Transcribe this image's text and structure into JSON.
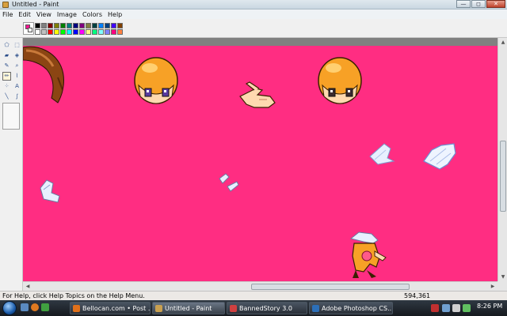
{
  "window": {
    "title": "Untitled - Paint"
  },
  "window_controls": {
    "minimize": "—",
    "maximize": "◻",
    "close": "✕"
  },
  "menu": [
    "File",
    "Edit",
    "View",
    "Image",
    "Colors",
    "Help"
  ],
  "palette": {
    "foreground": "#ff1493",
    "background": "#f2f2f2",
    "colors": [
      "#000000",
      "#808080",
      "#800000",
      "#808000",
      "#008000",
      "#008080",
      "#000080",
      "#800080",
      "#808040",
      "#004040",
      "#0080ff",
      "#004080",
      "#4000ff",
      "#804000",
      "#ffffff",
      "#c0c0c0",
      "#ff0000",
      "#ffff00",
      "#00ff00",
      "#00ffff",
      "#0000ff",
      "#ff00ff",
      "#ffff80",
      "#00ff80",
      "#80ffff",
      "#8080ff",
      "#ff0080",
      "#ff8040"
    ]
  },
  "tools": [
    {
      "name": "free-select-icon",
      "glyph": "⬠"
    },
    {
      "name": "rect-select-icon",
      "glyph": "⬚"
    },
    {
      "name": "eraser-icon",
      "glyph": "▰"
    },
    {
      "name": "fill-icon",
      "glyph": "◈"
    },
    {
      "name": "eyedropper-icon",
      "glyph": "✎"
    },
    {
      "name": "magnifier-icon",
      "glyph": "⌕"
    },
    {
      "name": "pencil-icon",
      "glyph": "✏",
      "active": true
    },
    {
      "name": "brush-icon",
      "glyph": "⌇"
    },
    {
      "name": "airbrush-icon",
      "glyph": "⁘"
    },
    {
      "name": "text-icon",
      "glyph": "A"
    },
    {
      "name": "line-icon",
      "glyph": "╲"
    },
    {
      "name": "curve-icon",
      "glyph": "∫"
    },
    {
      "name": "rectangle-icon",
      "glyph": "▭"
    },
    {
      "name": "polygon-icon",
      "glyph": "⬟"
    },
    {
      "name": "ellipse-icon",
      "glyph": "⬭"
    },
    {
      "name": "rounded-rect-icon",
      "glyph": "▢"
    }
  ],
  "canvas": {
    "background": "#ff2d82"
  },
  "status": {
    "help": "For Help, click Help Topics on the Help Menu.",
    "coords": "594,361"
  },
  "taskbar": {
    "tasks": [
      {
        "label": "Bellocan.com • Post ...",
        "color": "#e0701a"
      },
      {
        "label": "Untitled - Paint",
        "color": "#c9a050",
        "active": true
      },
      {
        "label": "BannedStory 3.0",
        "color": "#d04040"
      },
      {
        "label": "Adobe Photoshop CS...",
        "color": "#2c6fb8"
      }
    ],
    "clock": "8:26 PM"
  }
}
